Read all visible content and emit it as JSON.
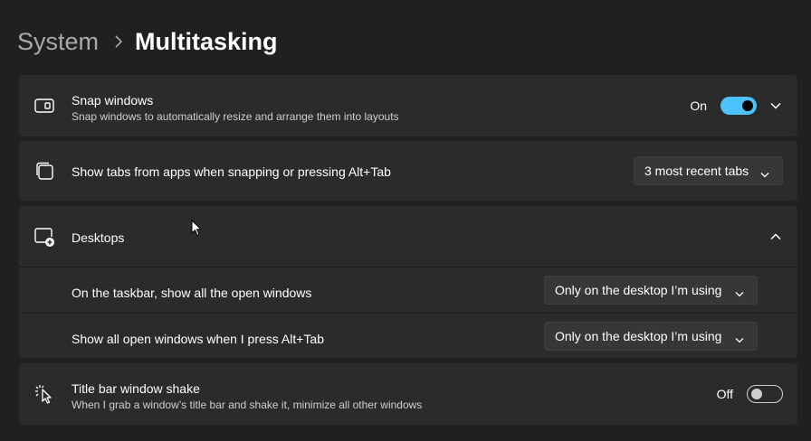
{
  "breadcrumb": {
    "parent": "System",
    "current": "Multitasking"
  },
  "settings": {
    "snap_windows": {
      "title": "Snap windows",
      "description": "Snap windows to automatically resize and arrange them into layouts",
      "toggle_state": "On",
      "icon": "snap-windows-icon"
    },
    "show_tabs": {
      "title": "Show tabs from apps when snapping or pressing Alt+Tab",
      "selected": "3 most recent tabs",
      "icon": "tabs-icon"
    },
    "desktops": {
      "title": "Desktops",
      "icon": "virtual-desktop-icon",
      "items": [
        {
          "label": "On the taskbar, show all the open windows",
          "selected": "Only on the desktop I’m using"
        },
        {
          "label": "Show all open windows when I press Alt+Tab",
          "selected": "Only on the desktop I’m using"
        }
      ]
    },
    "title_bar_shake": {
      "title": "Title bar window shake",
      "description": "When I grab a window’s title bar and shake it, minimize all other windows",
      "toggle_state": "Off",
      "icon": "window-shake-icon"
    }
  },
  "colors": {
    "background": "#202020",
    "card": "#2b2b2b",
    "accent": "#4cc2ff"
  }
}
